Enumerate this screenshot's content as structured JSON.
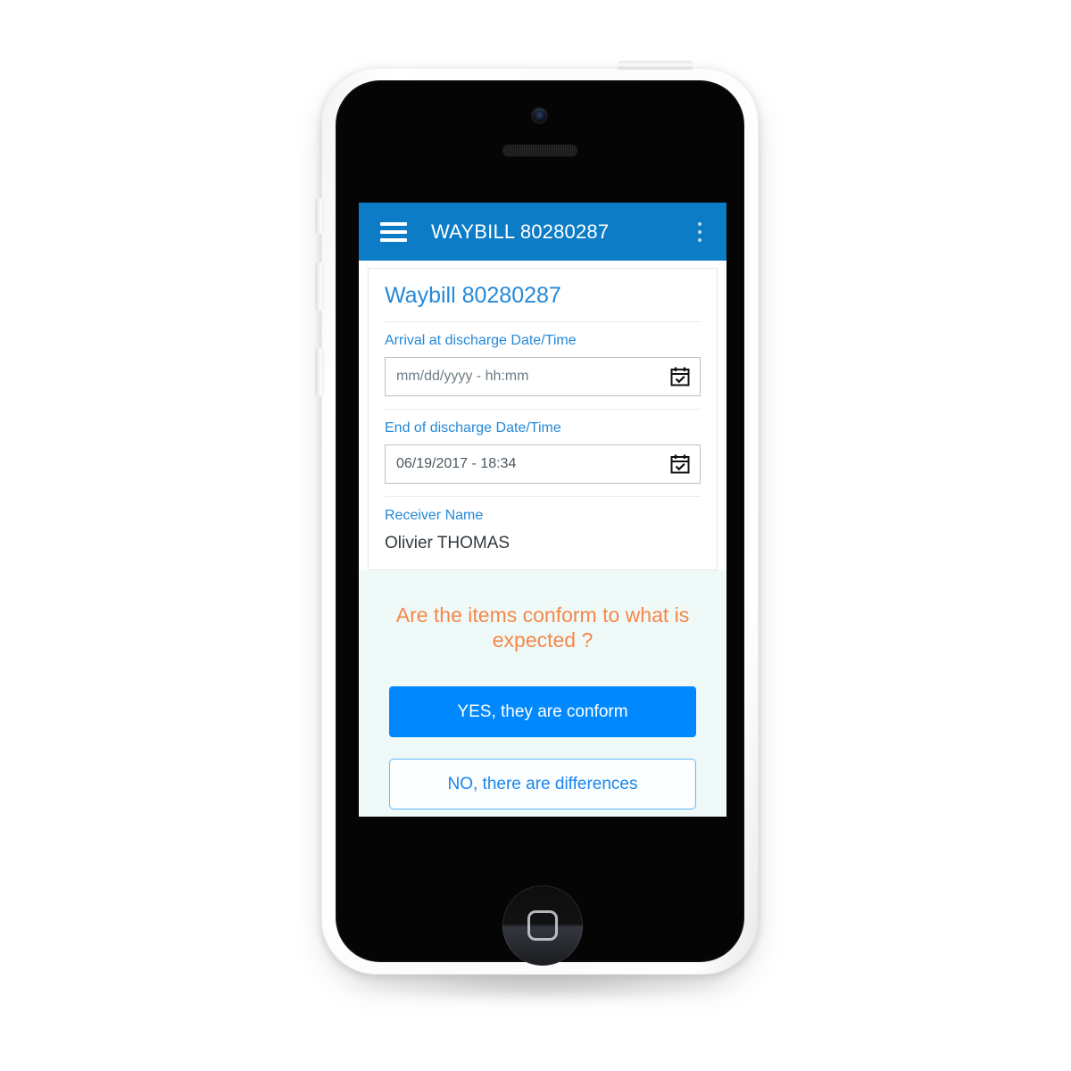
{
  "appbar": {
    "menu_icon": "hamburger-menu-icon",
    "title": "WAYBILL 80280287",
    "overflow_icon": "more-vertical-icon"
  },
  "card": {
    "title": "Waybill 80280287",
    "fields": [
      {
        "label": "Arrival at discharge Date/Time",
        "value": "",
        "placeholder": "mm/dd/yyyy - hh:mm",
        "icon": "calendar-check-icon"
      },
      {
        "label": "End of discharge Date/Time",
        "value": "06/19/2017 - 18:34",
        "placeholder": "mm/dd/yyyy - hh:mm",
        "icon": "calendar-check-icon"
      }
    ],
    "receiver": {
      "label": "Receiver Name",
      "value": "Olivier THOMAS"
    }
  },
  "conform": {
    "question": "Are the items conform to what is expected ?",
    "yes_label": "YES, they are conform",
    "no_label": "NO, there are differences"
  },
  "colors": {
    "appbar_blue": "#0c7cc6",
    "link_blue": "#2489d8",
    "primary_button_blue": "#0089ff",
    "question_orange": "#f5874a",
    "conform_background": "#effaf8"
  }
}
